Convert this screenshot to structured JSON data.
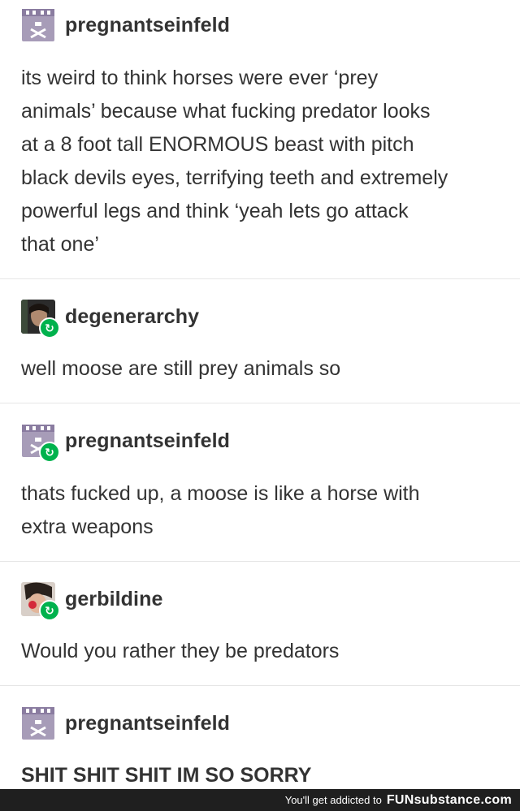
{
  "posts": [
    {
      "username": "pregnantseinfeld",
      "avatar": "seinfeld-avatar-icon",
      "text_lines": [
        "its weird to think horses were ever ‘prey",
        "animals’ because what fucking predator looks",
        "at a 8 foot tall ENORMOUS beast with pitch",
        "black devils eyes, terrifying teeth and extremely",
        "powerful legs and think ‘yeah lets go attack",
        "that one’"
      ]
    },
    {
      "username": "degenerarchy",
      "avatar": "photo-avatar",
      "text_lines": [
        "well moose are still prey animals so"
      ]
    },
    {
      "username": "pregnantseinfeld",
      "avatar": "seinfeld-avatar-icon",
      "text_lines": [
        "thats fucked up, a moose is like a horse with",
        "extra weapons"
      ]
    },
    {
      "username": "gerbildine",
      "avatar": "photo-avatar",
      "text_lines": [
        "Would you rather they be predators"
      ]
    },
    {
      "username": "pregnantseinfeld",
      "avatar": "seinfeld-avatar-icon",
      "text_lines": [
        "SHIT SHIT SHIT IM SO SORRY"
      ]
    }
  ],
  "reblog_icon": "reblog-icon",
  "footer": {
    "tagline": "You'll get addicted to",
    "brand": "FUNsubstance.com"
  },
  "colors": {
    "reblog_badge": "#00b24d",
    "seinfeld_avatar_bg": "#9c8fb0",
    "footer_bg": "#1f1f1f"
  }
}
